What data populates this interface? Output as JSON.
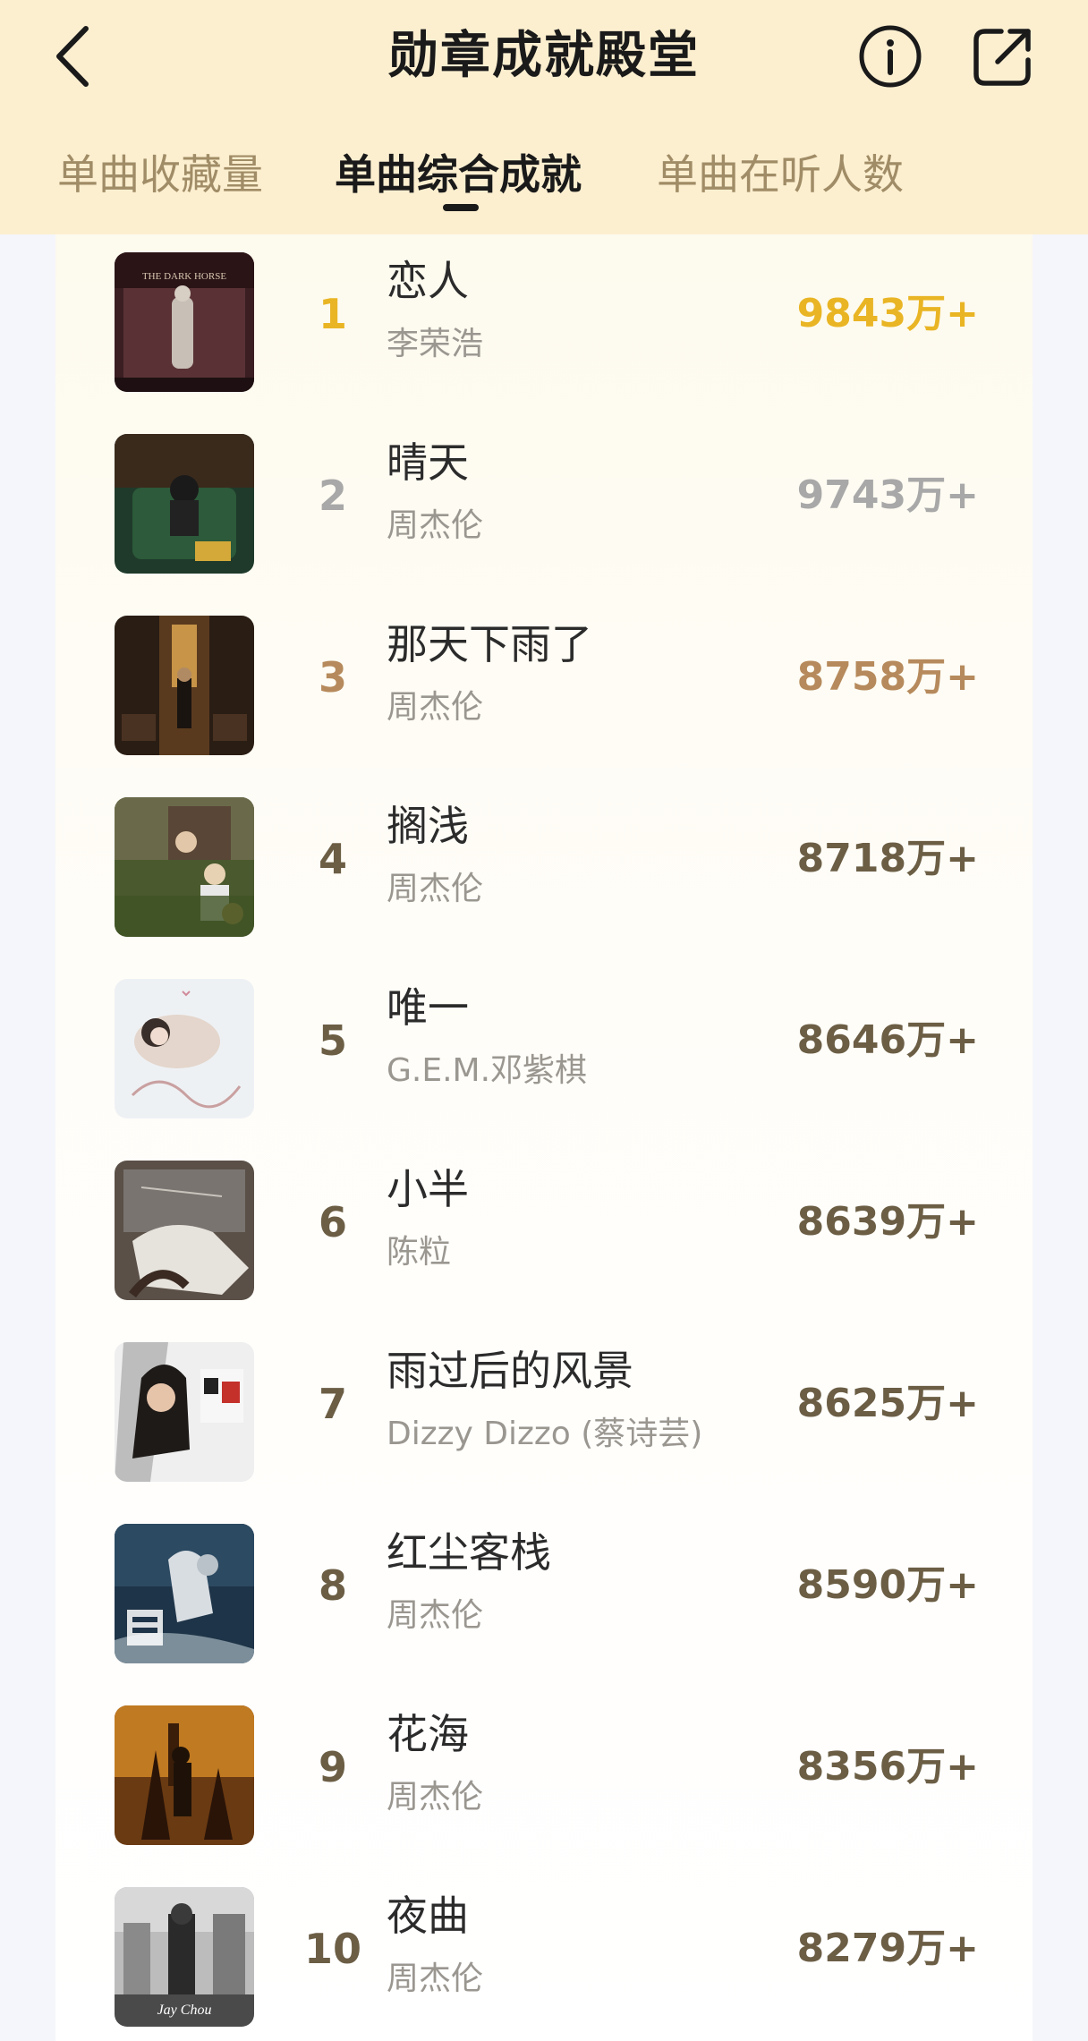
{
  "header": {
    "title": "勋章成就殿堂",
    "back_icon": "chevron-left-icon",
    "info_icon": "info-circle-icon",
    "share_icon": "share-icon"
  },
  "tabs": [
    {
      "label": "单曲收藏量",
      "active": false
    },
    {
      "label": "单曲综合成就",
      "active": true
    },
    {
      "label": "单曲在听人数",
      "active": false
    }
  ],
  "colors": {
    "header_bg": "#fcefd0",
    "gold": "#e9b524",
    "silver": "#a8a8a8",
    "bronze": "#b68a5c",
    "default_rank": "#6b5e45"
  },
  "rankings": [
    {
      "rank": "1",
      "song": "恋人",
      "artist": "李荣浩",
      "count": "9843万+"
    },
    {
      "rank": "2",
      "song": "晴天",
      "artist": "周杰伦",
      "count": "9743万+"
    },
    {
      "rank": "3",
      "song": "那天下雨了",
      "artist": "周杰伦",
      "count": "8758万+"
    },
    {
      "rank": "4",
      "song": "搁浅",
      "artist": "周杰伦",
      "count": "8718万+"
    },
    {
      "rank": "5",
      "song": "唯一",
      "artist": "G.E.M.邓紫棋",
      "count": "8646万+"
    },
    {
      "rank": "6",
      "song": "小半",
      "artist": "陈粒",
      "count": "8639万+"
    },
    {
      "rank": "7",
      "song": "雨过后的风景",
      "artist": "Dizzy Dizzo (蔡诗芸)",
      "count": "8625万+"
    },
    {
      "rank": "8",
      "song": "红尘客栈",
      "artist": "周杰伦",
      "count": "8590万+"
    },
    {
      "rank": "9",
      "song": "花海",
      "artist": "周杰伦",
      "count": "8356万+"
    },
    {
      "rank": "10",
      "song": "夜曲",
      "artist": "周杰伦",
      "count": "8279万+"
    }
  ]
}
